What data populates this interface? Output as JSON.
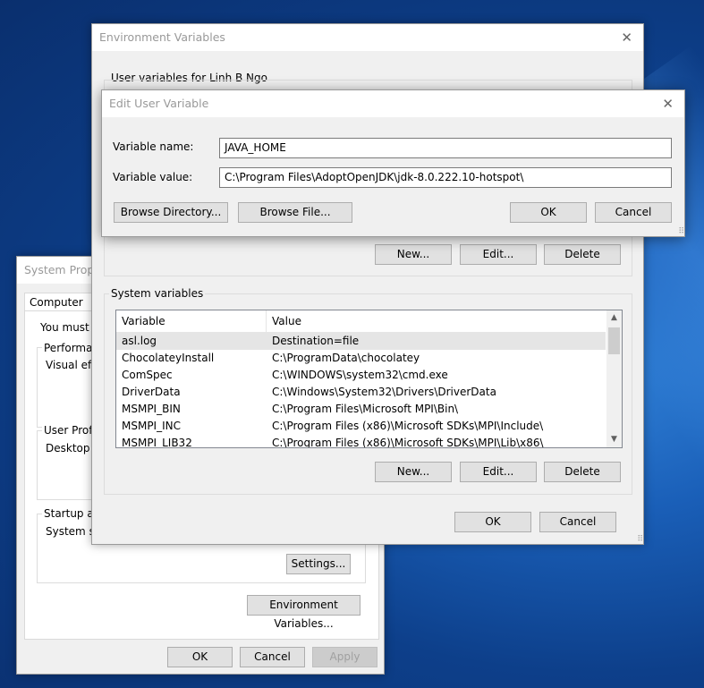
{
  "system_properties": {
    "title": "System Prope",
    "tab": "Computer Nam",
    "intro": "You must be",
    "performance_label": "Performanc",
    "performance_text": "Visual effec",
    "user_profiles_label": "User Profile",
    "user_profiles_text": "Desktop se",
    "startup_label": "Startup and",
    "startup_text": "System star",
    "settings_button": "Settings...",
    "env_vars_button": "Environment Variables...",
    "ok_button": "OK",
    "cancel_button": "Cancel",
    "apply_button": "Apply"
  },
  "env_vars": {
    "title": "Environment Variables",
    "user_section_label": "User variables for Linh B Ngo",
    "user_buttons": {
      "new": "New...",
      "edit": "Edit...",
      "delete": "Delete"
    },
    "system_section_label": "System variables",
    "columns": [
      "Variable",
      "Value"
    ],
    "system_rows": [
      {
        "name": "asl.log",
        "value": "Destination=file"
      },
      {
        "name": "ChocolateyInstall",
        "value": "C:\\ProgramData\\chocolatey"
      },
      {
        "name": "ComSpec",
        "value": "C:\\WINDOWS\\system32\\cmd.exe"
      },
      {
        "name": "DriverData",
        "value": "C:\\Windows\\System32\\Drivers\\DriverData"
      },
      {
        "name": "MSMPI_BIN",
        "value": "C:\\Program Files\\Microsoft MPI\\Bin\\"
      },
      {
        "name": "MSMPI_INC",
        "value": "C:\\Program Files (x86)\\Microsoft SDKs\\MPI\\Include\\"
      },
      {
        "name": "MSMPI_LIB32",
        "value": "C:\\Program Files (x86)\\Microsoft SDKs\\MPI\\Lib\\x86\\"
      }
    ],
    "system_buttons": {
      "new": "New...",
      "edit": "Edit...",
      "delete": "Delete"
    },
    "ok_button": "OK",
    "cancel_button": "Cancel"
  },
  "edit_user_var": {
    "title": "Edit User Variable",
    "name_label": "Variable name:",
    "name_value": "JAVA_HOME",
    "value_label": "Variable value:",
    "value_value": "C:\\Program Files\\AdoptOpenJDK\\jdk-8.0.222.10-hotspot\\",
    "browse_directory_button": "Browse Directory...",
    "browse_file_button": "Browse File...",
    "ok_button": "OK",
    "cancel_button": "Cancel"
  },
  "icons": {
    "close": "close-icon",
    "scroll_up": "chevron-up-icon",
    "scroll_down": "chevron-down-icon",
    "resize": "resize-grip-icon"
  },
  "colors": {
    "desktop": "#0d3f8a",
    "selected_row": "#e5e5e5",
    "button_face": "#e1e1e1"
  }
}
